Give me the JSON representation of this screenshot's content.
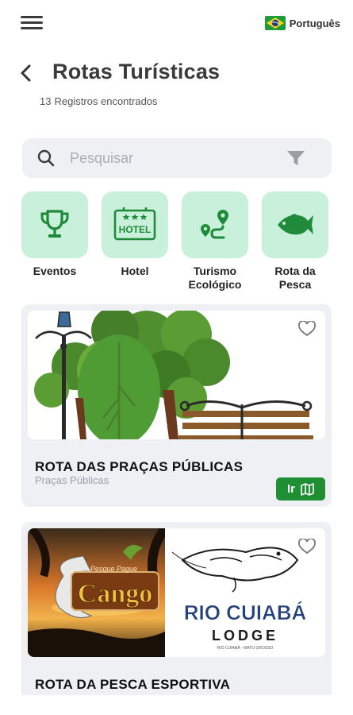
{
  "topbar": {
    "menu_icon": "hamburger-menu-icon",
    "language": {
      "flag_icon": "brazil-flag-icon",
      "label": "Português"
    }
  },
  "header": {
    "back_icon": "chevron-left-icon",
    "title": "Rotas Turísticas",
    "records_count": "13",
    "records_label": "Registros encontrados"
  },
  "search": {
    "placeholder": "Pesquisar",
    "search_icon": "search-icon",
    "filter_icon": "filter-icon"
  },
  "categories": [
    {
      "label": "Eventos",
      "icon": "trophy-icon"
    },
    {
      "label": "Hotel",
      "icon": "hotel-sign-icon",
      "icon_text": "HOTEL"
    },
    {
      "label": "Turismo Ecológico",
      "icon": "route-map-icon"
    },
    {
      "label": "Rota da Pesca",
      "icon": "fish-icon"
    }
  ],
  "routes": [
    {
      "title": "ROTA DAS PRAÇAS PÚBLICAS",
      "subtitle": "Praças Públicas",
      "button_label": "Ir",
      "button_icon": "map-icon",
      "favorite_icon": "heart-icon"
    },
    {
      "title": "ROTA DA PESCA ESPORTIVA",
      "favorite_icon": "heart-icon",
      "logo_left": {
        "top": "Pesque Pague",
        "main": "Cango"
      },
      "logo_right": {
        "main": "RIO CUIABÁ",
        "sub": "LODGE",
        "tagline": "RIO CUIABÁ - MATO GROSSO"
      }
    }
  ],
  "colors": {
    "accent_green": "#1f8f33",
    "tile_green": "#c9f0da",
    "card_bg": "#eef0f3",
    "icon_green": "#1e8a3a"
  }
}
